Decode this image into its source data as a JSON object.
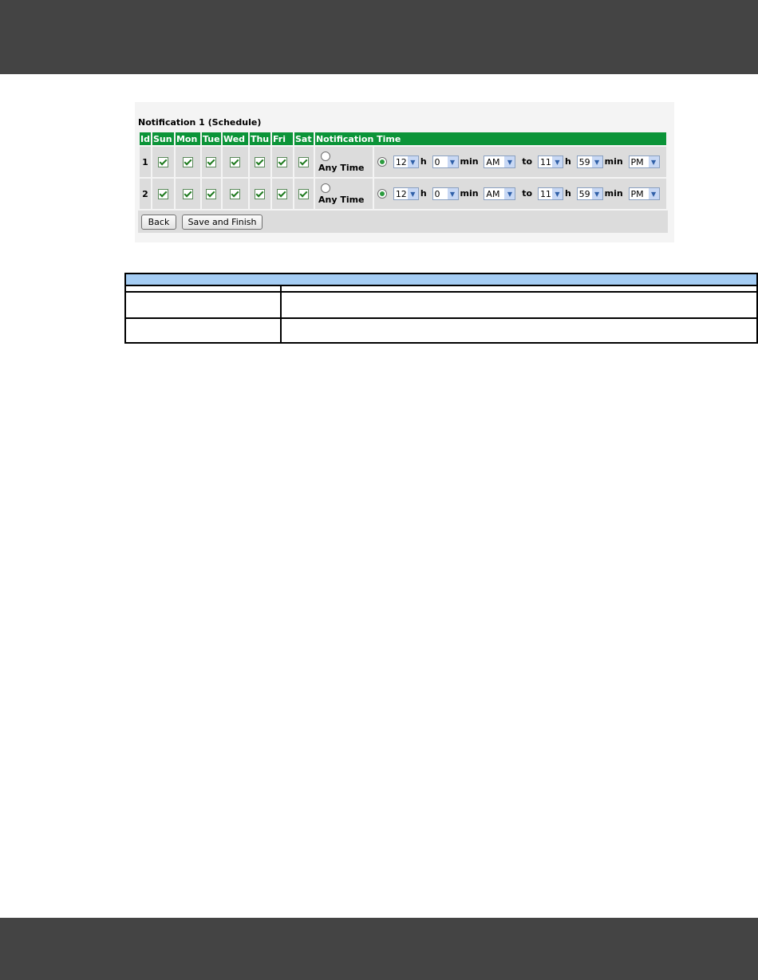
{
  "panel_title": "Notification 1 (Schedule)",
  "headers": [
    "Id",
    "Sun",
    "Mon",
    "Tue",
    "Wed",
    "Thu",
    "Fri",
    "Sat",
    "Notification Time"
  ],
  "any_time_label": "Any Time",
  "units": {
    "hour": "h",
    "minute": "min",
    "to": "to"
  },
  "rows": [
    {
      "id": "1",
      "days_checked": [
        true,
        true,
        true,
        true,
        true,
        true,
        true
      ],
      "any_time_selected": false,
      "range_selected": true,
      "start": {
        "hour": "12",
        "minute": "0",
        "ampm": "AM"
      },
      "end": {
        "hour": "11",
        "minute": "59",
        "ampm": "PM"
      }
    },
    {
      "id": "2",
      "days_checked": [
        true,
        true,
        true,
        true,
        true,
        true,
        true
      ],
      "any_time_selected": false,
      "range_selected": true,
      "start": {
        "hour": "12",
        "minute": "0",
        "ampm": "AM"
      },
      "end": {
        "hour": "11",
        "minute": "59",
        "ampm": "PM"
      }
    }
  ],
  "buttons": {
    "back": "Back",
    "save_finish": "Save and Finish"
  },
  "colors": {
    "header_green": "#0b9438",
    "ref_header_blue": "#a5cdf4",
    "frame_dark": "#444444"
  }
}
